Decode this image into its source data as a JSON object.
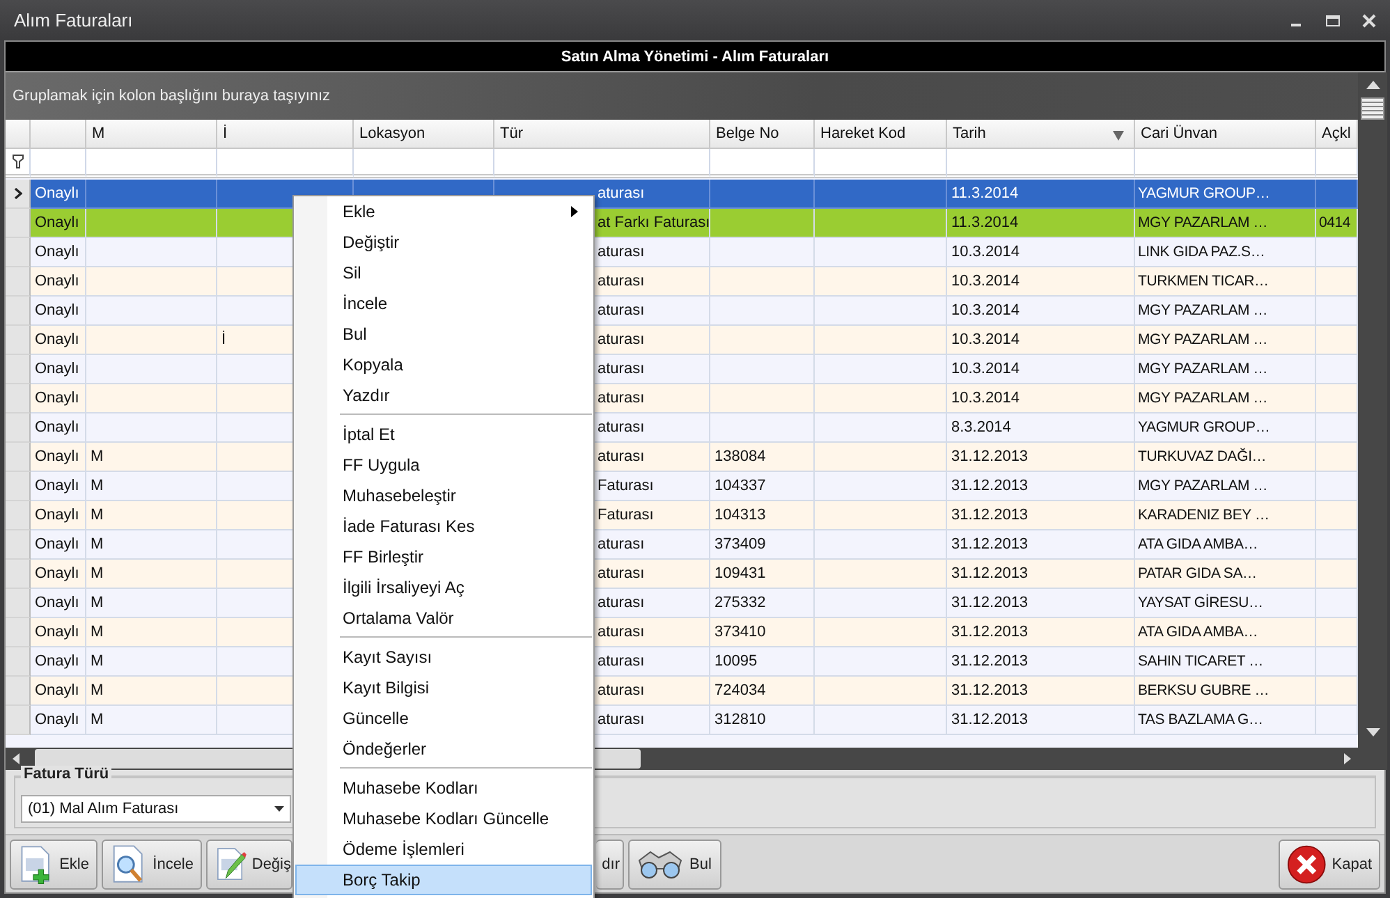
{
  "window": {
    "title": "Alım Faturaları"
  },
  "header": {
    "title": "Satın Alma Yönetimi - Alım Faturaları"
  },
  "group_panel": {
    "hint": "Gruplamak için kolon başlığını buraya taşıyınız"
  },
  "table": {
    "columns": [
      {
        "label": "M",
        "sorted": false
      },
      {
        "label": "İ",
        "sorted": false
      },
      {
        "label": "Lokasyon",
        "sorted": false
      },
      {
        "label": "Tür",
        "sorted": false
      },
      {
        "label": "Belge No",
        "sorted": false
      },
      {
        "label": "Hareket Kod",
        "sorted": false
      },
      {
        "label": "Tarih",
        "sorted": true
      },
      {
        "label": "Cari Ünvan",
        "sorted": false
      },
      {
        "label": "Açkl",
        "sorted": false
      }
    ],
    "rows": [
      {
        "selected": true,
        "cells": {
          "column_1": "Onaylı",
          "tur": "aturası",
          "tarih": "11.3.2014",
          "cari_unvan": "YAGMUR GROUP…"
        }
      },
      {
        "selected": false,
        "color": "#9acd32",
        "cells": {
          "column_1": "Onaylı",
          "tur": "at Farkı Faturası",
          "tarih": "11.3.2014",
          "cari_unvan": "MGY PAZARLAM …",
          "aciklama": "0414"
        }
      },
      {
        "selected": false,
        "cells": {
          "column_1": "Onaylı",
          "tur": "aturası",
          "tarih": "10.3.2014",
          "cari_unvan": "LINK GIDA PAZ.S…"
        }
      },
      {
        "selected": false,
        "cells": {
          "column_1": "Onaylı",
          "tur": "aturası",
          "tarih": "10.3.2014",
          "cari_unvan": "TURKMEN TICAR…"
        }
      },
      {
        "selected": false,
        "cells": {
          "column_1": "Onaylı",
          "tur": "aturası",
          "tarih": "10.3.2014",
          "cari_unvan": "MGY PAZARLAM …"
        }
      },
      {
        "selected": false,
        "cells": {
          "column_1": "Onaylı",
          "i": "İ",
          "tur": "aturası",
          "tarih": "10.3.2014",
          "cari_unvan": "MGY PAZARLAM …"
        }
      },
      {
        "selected": false,
        "cells": {
          "column_1": "Onaylı",
          "tur": "aturası",
          "tarih": "10.3.2014",
          "cari_unvan": "MGY PAZARLAM …"
        }
      },
      {
        "selected": false,
        "cells": {
          "column_1": "Onaylı",
          "tur": "aturası",
          "tarih": "10.3.2014",
          "cari_unvan": "MGY PAZARLAM …"
        }
      },
      {
        "selected": false,
        "cells": {
          "column_1": "Onaylı",
          "tur": "aturası",
          "tarih": "8.3.2014",
          "cari_unvan": "YAGMUR GROUP…"
        }
      },
      {
        "selected": false,
        "cells": {
          "column_1": "Onaylı",
          "m": "M",
          "tur": "aturası",
          "belge_no": "138084",
          "tarih": "31.12.2013",
          "cari_unvan": "TURKUVAZ DAĞI…"
        }
      },
      {
        "selected": false,
        "cells": {
          "column_1": "Onaylı",
          "m": "M",
          "tur": "Faturası",
          "belge_no": "104337",
          "tarih": "31.12.2013",
          "cari_unvan": "MGY PAZARLAM …"
        }
      },
      {
        "selected": false,
        "cells": {
          "column_1": "Onaylı",
          "m": "M",
          "tur": "Faturası",
          "belge_no": "104313",
          "tarih": "31.12.2013",
          "cari_unvan": "KARADENIZ BEY …"
        }
      },
      {
        "selected": false,
        "cells": {
          "column_1": "Onaylı",
          "m": "M",
          "tur": "aturası",
          "belge_no": "373409",
          "tarih": "31.12.2013",
          "cari_unvan": "ATA GIDA AMBA…"
        }
      },
      {
        "selected": false,
        "cells": {
          "column_1": "Onaylı",
          "m": "M",
          "tur": "aturası",
          "belge_no": "109431",
          "tarih": "31.12.2013",
          "cari_unvan": "PATAR GIDA SA…"
        }
      },
      {
        "selected": false,
        "cells": {
          "column_1": "Onaylı",
          "m": "M",
          "tur": "aturası",
          "belge_no": "275332",
          "tarih": "31.12.2013",
          "cari_unvan": "YAYSAT GİRESU…"
        }
      },
      {
        "selected": false,
        "cells": {
          "column_1": "Onaylı",
          "m": "M",
          "tur": "aturası",
          "belge_no": "373410",
          "tarih": "31.12.2013",
          "cari_unvan": "ATA GIDA AMBA…"
        }
      },
      {
        "selected": false,
        "cells": {
          "column_1": "Onaylı",
          "m": "M",
          "tur": "aturası",
          "belge_no": "10095",
          "tarih": "31.12.2013",
          "cari_unvan": "SAHIN TICARET …"
        }
      },
      {
        "selected": false,
        "cells": {
          "column_1": "Onaylı",
          "m": "M",
          "tur": "aturası",
          "belge_no": "724034",
          "tarih": "31.12.2013",
          "cari_unvan": "BERKSU GUBRE …"
        }
      },
      {
        "selected": false,
        "cells": {
          "column_1": "Onaylı",
          "m": "M",
          "tur": "aturası",
          "belge_no": "312810",
          "tarih": "31.12.2013",
          "cari_unvan": "TAS BAZLAMA G…"
        }
      }
    ]
  },
  "fatura_turu": {
    "label": "Fatura Türü",
    "value": "(01) Mal Alım Faturası"
  },
  "toolbar": [
    {
      "kind": "add",
      "label": "Ekle"
    },
    {
      "kind": "inspect",
      "label": "İncele"
    },
    {
      "kind": "edit",
      "label": "Değiş"
    },
    {
      "kind": "hidden",
      "label": "dır"
    },
    {
      "kind": "find",
      "label": "Bul"
    }
  ],
  "close_button": {
    "label": "Kapat"
  },
  "context_menu": {
    "groups": [
      [
        {
          "label": "Ekle",
          "submenu": true,
          "selected": false
        },
        {
          "label": "Değiştir",
          "submenu": false,
          "selected": false
        },
        {
          "label": "Sil",
          "submenu": false,
          "selected": false
        },
        {
          "label": "İncele",
          "submenu": false,
          "selected": false
        },
        {
          "label": "Bul",
          "submenu": false,
          "selected": false
        },
        {
          "label": "Kopyala",
          "submenu": false,
          "selected": false
        },
        {
          "label": "Yazdır",
          "submenu": false,
          "selected": false
        }
      ],
      [
        {
          "label": "İptal Et",
          "submenu": false,
          "selected": false
        },
        {
          "label": "FF Uygula",
          "submenu": false,
          "selected": false
        },
        {
          "label": "Muhasebeleştir",
          "submenu": false,
          "selected": false
        },
        {
          "label": "İade Faturası Kes",
          "submenu": false,
          "selected": false
        },
        {
          "label": "FF Birleştir",
          "submenu": false,
          "selected": false
        },
        {
          "label": "İlgili İrsaliyeyi Aç",
          "submenu": false,
          "selected": false
        },
        {
          "label": "Ortalama Valör",
          "submenu": false,
          "selected": false
        }
      ],
      [
        {
          "label": "Kayıt Sayısı",
          "submenu": false,
          "selected": false
        },
        {
          "label": "Kayıt Bilgisi",
          "submenu": false,
          "selected": false
        },
        {
          "label": "Güncelle",
          "submenu": false,
          "selected": false
        },
        {
          "label": "Öndeğerler",
          "submenu": false,
          "selected": false
        }
      ],
      [
        {
          "label": "Muhasebe Kodları",
          "submenu": false,
          "selected": false
        },
        {
          "label": "Muhasebe Kodları Güncelle",
          "submenu": false,
          "selected": false
        },
        {
          "label": "Ödeme İşlemleri",
          "submenu": false,
          "selected": false
        },
        {
          "label": "Borç Takip",
          "submenu": false,
          "selected": true
        }
      ]
    ]
  }
}
